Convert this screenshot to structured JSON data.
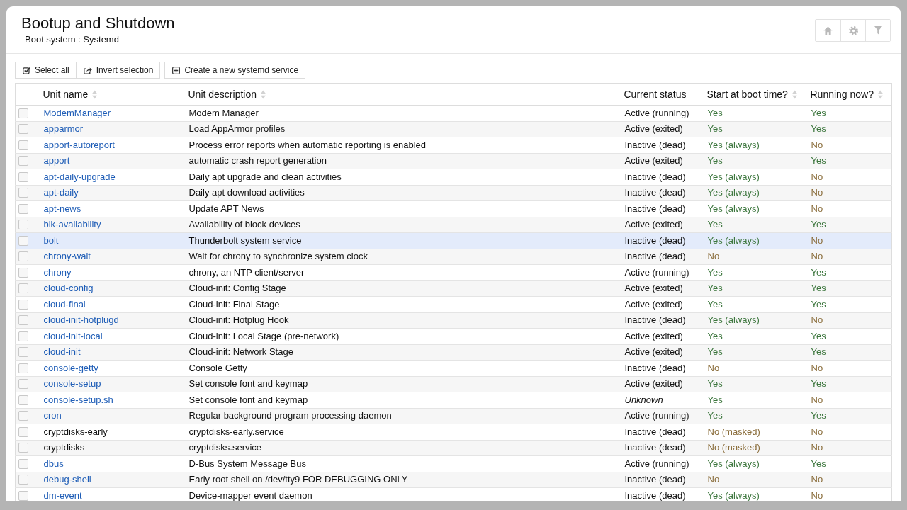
{
  "page": {
    "title": "Bootup and Shutdown",
    "subtitle": "Boot system : Systemd"
  },
  "toolbar": [
    {
      "buttons": [
        {
          "kind": "select_all",
          "label": "Select all"
        },
        {
          "kind": "invert",
          "label": "Invert selection"
        }
      ]
    },
    {
      "buttons": [
        {
          "kind": "create",
          "label": "Create a new systemd service"
        }
      ]
    }
  ],
  "table": {
    "columns": [
      {
        "label": "Unit name",
        "sortable": true
      },
      {
        "label": "Unit description",
        "sortable": true
      },
      {
        "label": "Current status",
        "sortable": false
      },
      {
        "label": "Start at boot time?",
        "sortable": true
      },
      {
        "label": "Running now?",
        "sortable": true
      }
    ],
    "rows": [
      {
        "checked": false,
        "highlighted": false,
        "name": "ModemManager",
        "linked": true,
        "description": "Modem Manager",
        "status": "Active (running)",
        "status_known": true,
        "boot": "Yes",
        "boot_enabled": true,
        "running": "Yes",
        "running_on": true
      },
      {
        "checked": false,
        "highlighted": false,
        "name": "apparmor",
        "linked": true,
        "description": "Load AppArmor profiles",
        "status": "Active (exited)",
        "status_known": true,
        "boot": "Yes",
        "boot_enabled": true,
        "running": "Yes",
        "running_on": true
      },
      {
        "checked": false,
        "highlighted": false,
        "name": "apport-autoreport",
        "linked": true,
        "description": "Process error reports when automatic reporting is enabled",
        "status": "Inactive (dead)",
        "status_known": true,
        "boot": "Yes (always)",
        "boot_enabled": true,
        "running": "No",
        "running_on": false
      },
      {
        "checked": false,
        "highlighted": false,
        "name": "apport",
        "linked": true,
        "description": "automatic crash report generation",
        "status": "Active (exited)",
        "status_known": true,
        "boot": "Yes",
        "boot_enabled": true,
        "running": "Yes",
        "running_on": true
      },
      {
        "checked": false,
        "highlighted": false,
        "name": "apt-daily-upgrade",
        "linked": true,
        "description": "Daily apt upgrade and clean activities",
        "status": "Inactive (dead)",
        "status_known": true,
        "boot": "Yes (always)",
        "boot_enabled": true,
        "running": "No",
        "running_on": false
      },
      {
        "checked": false,
        "highlighted": false,
        "name": "apt-daily",
        "linked": true,
        "description": "Daily apt download activities",
        "status": "Inactive (dead)",
        "status_known": true,
        "boot": "Yes (always)",
        "boot_enabled": true,
        "running": "No",
        "running_on": false
      },
      {
        "checked": false,
        "highlighted": false,
        "name": "apt-news",
        "linked": true,
        "description": "Update APT News",
        "status": "Inactive (dead)",
        "status_known": true,
        "boot": "Yes (always)",
        "boot_enabled": true,
        "running": "No",
        "running_on": false
      },
      {
        "checked": false,
        "highlighted": false,
        "name": "blk-availability",
        "linked": true,
        "description": "Availability of block devices",
        "status": "Active (exited)",
        "status_known": true,
        "boot": "Yes",
        "boot_enabled": true,
        "running": "Yes",
        "running_on": true
      },
      {
        "checked": false,
        "highlighted": true,
        "name": "bolt",
        "linked": true,
        "description": "Thunderbolt system service",
        "status": "Inactive (dead)",
        "status_known": true,
        "boot": "Yes (always)",
        "boot_enabled": true,
        "running": "No",
        "running_on": false
      },
      {
        "checked": false,
        "highlighted": false,
        "name": "chrony-wait",
        "linked": true,
        "description": "Wait for chrony to synchronize system clock",
        "status": "Inactive (dead)",
        "status_known": true,
        "boot": "No",
        "boot_enabled": false,
        "running": "No",
        "running_on": false
      },
      {
        "checked": false,
        "highlighted": false,
        "name": "chrony",
        "linked": true,
        "description": "chrony, an NTP client/server",
        "status": "Active (running)",
        "status_known": true,
        "boot": "Yes",
        "boot_enabled": true,
        "running": "Yes",
        "running_on": true
      },
      {
        "checked": false,
        "highlighted": false,
        "name": "cloud-config",
        "linked": true,
        "description": "Cloud-init: Config Stage",
        "status": "Active (exited)",
        "status_known": true,
        "boot": "Yes",
        "boot_enabled": true,
        "running": "Yes",
        "running_on": true
      },
      {
        "checked": false,
        "highlighted": false,
        "name": "cloud-final",
        "linked": true,
        "description": "Cloud-init: Final Stage",
        "status": "Active (exited)",
        "status_known": true,
        "boot": "Yes",
        "boot_enabled": true,
        "running": "Yes",
        "running_on": true
      },
      {
        "checked": false,
        "highlighted": false,
        "name": "cloud-init-hotplugd",
        "linked": true,
        "description": "Cloud-init: Hotplug Hook",
        "status": "Inactive (dead)",
        "status_known": true,
        "boot": "Yes (always)",
        "boot_enabled": true,
        "running": "No",
        "running_on": false
      },
      {
        "checked": false,
        "highlighted": false,
        "name": "cloud-init-local",
        "linked": true,
        "description": "Cloud-init: Local Stage (pre-network)",
        "status": "Active (exited)",
        "status_known": true,
        "boot": "Yes",
        "boot_enabled": true,
        "running": "Yes",
        "running_on": true
      },
      {
        "checked": false,
        "highlighted": false,
        "name": "cloud-init",
        "linked": true,
        "description": "Cloud-init: Network Stage",
        "status": "Active (exited)",
        "status_known": true,
        "boot": "Yes",
        "boot_enabled": true,
        "running": "Yes",
        "running_on": true
      },
      {
        "checked": false,
        "highlighted": false,
        "name": "console-getty",
        "linked": true,
        "description": "Console Getty",
        "status": "Inactive (dead)",
        "status_known": true,
        "boot": "No",
        "boot_enabled": false,
        "running": "No",
        "running_on": false
      },
      {
        "checked": false,
        "highlighted": false,
        "name": "console-setup",
        "linked": true,
        "description": "Set console font and keymap",
        "status": "Active (exited)",
        "status_known": true,
        "boot": "Yes",
        "boot_enabled": true,
        "running": "Yes",
        "running_on": true
      },
      {
        "checked": false,
        "highlighted": false,
        "name": "console-setup.sh",
        "linked": true,
        "description": "Set console font and keymap",
        "status": "Unknown",
        "status_known": false,
        "boot": "Yes",
        "boot_enabled": true,
        "running": "No",
        "running_on": false
      },
      {
        "checked": false,
        "highlighted": false,
        "name": "cron",
        "linked": true,
        "description": "Regular background program processing daemon",
        "status": "Active (running)",
        "status_known": true,
        "boot": "Yes",
        "boot_enabled": true,
        "running": "Yes",
        "running_on": true
      },
      {
        "checked": false,
        "highlighted": false,
        "name": "cryptdisks-early",
        "linked": false,
        "description": "cryptdisks-early.service",
        "status": "Inactive (dead)",
        "status_known": true,
        "boot": "No (masked)",
        "boot_enabled": false,
        "running": "No",
        "running_on": false
      },
      {
        "checked": false,
        "highlighted": false,
        "name": "cryptdisks",
        "linked": false,
        "description": "cryptdisks.service",
        "status": "Inactive (dead)",
        "status_known": true,
        "boot": "No (masked)",
        "boot_enabled": false,
        "running": "No",
        "running_on": false
      },
      {
        "checked": false,
        "highlighted": false,
        "name": "dbus",
        "linked": true,
        "description": "D-Bus System Message Bus",
        "status": "Active (running)",
        "status_known": true,
        "boot": "Yes (always)",
        "boot_enabled": true,
        "running": "Yes",
        "running_on": true
      },
      {
        "checked": false,
        "highlighted": false,
        "name": "debug-shell",
        "linked": true,
        "description": "Early root shell on /dev/tty9 FOR DEBUGGING ONLY",
        "status": "Inactive (dead)",
        "status_known": true,
        "boot": "No",
        "boot_enabled": false,
        "running": "No",
        "running_on": false
      },
      {
        "checked": false,
        "highlighted": false,
        "name": "dm-event",
        "linked": true,
        "description": "Device-mapper event daemon",
        "status": "Inactive (dead)",
        "status_known": true,
        "boot": "Yes (always)",
        "boot_enabled": true,
        "running": "No",
        "running_on": false
      }
    ]
  }
}
